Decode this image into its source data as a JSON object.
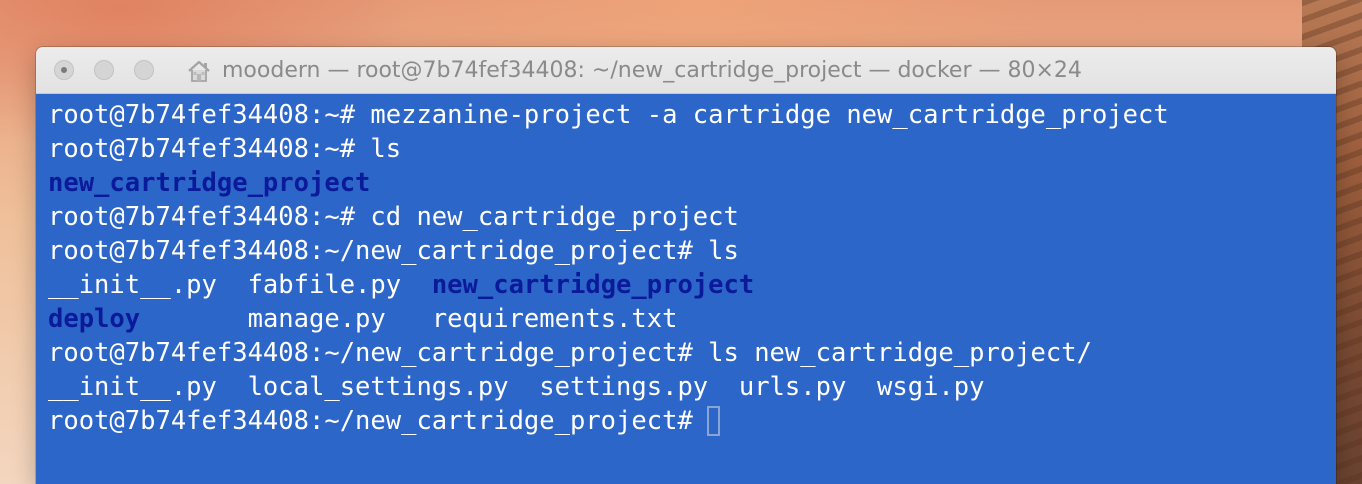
{
  "window": {
    "title": "moodern — root@7b74fef34408: ~/new_cartridge_project — docker — 80×24"
  },
  "icons": {
    "title_icon": "home-icon"
  },
  "colors": {
    "terminal_bg": "#2c66c8",
    "terminal_fg": "#ffffff",
    "directory_fg": "#0a1a9a"
  },
  "terminal": {
    "lines": [
      {
        "segments": [
          {
            "text": "root@7b74fef34408:~# mezzanine-project -a cartridge new_cartridge_project",
            "type": "text"
          }
        ]
      },
      {
        "segments": [
          {
            "text": "root@7b74fef34408:~# ls",
            "type": "text"
          }
        ]
      },
      {
        "segments": [
          {
            "text": "new_cartridge_project",
            "type": "dir"
          }
        ]
      },
      {
        "segments": [
          {
            "text": "root@7b74fef34408:~# cd new_cartridge_project",
            "type": "text"
          }
        ]
      },
      {
        "segments": [
          {
            "text": "root@7b74fef34408:~/new_cartridge_project# ls",
            "type": "text"
          }
        ]
      },
      {
        "segments": [
          {
            "text": "__init__.py  fabfile.py  ",
            "type": "text"
          },
          {
            "text": "new_cartridge_project",
            "type": "dir"
          }
        ]
      },
      {
        "segments": [
          {
            "text": "deploy",
            "type": "dir"
          },
          {
            "text": "       manage.py   requirements.txt",
            "type": "text"
          }
        ]
      },
      {
        "segments": [
          {
            "text": "root@7b74fef34408:~/new_cartridge_project# ls new_cartridge_project/",
            "type": "text"
          }
        ]
      },
      {
        "segments": [
          {
            "text": "__init__.py  local_settings.py  settings.py  urls.py  wsgi.py",
            "type": "text"
          }
        ]
      },
      {
        "segments": [
          {
            "text": "root@7b74fef34408:~/new_cartridge_project#",
            "type": "text"
          }
        ],
        "cursor": true
      }
    ]
  }
}
